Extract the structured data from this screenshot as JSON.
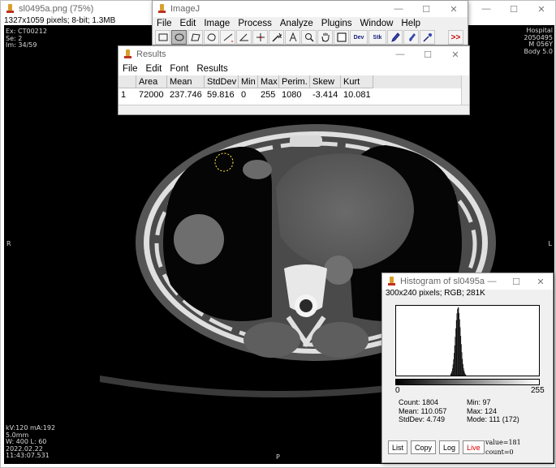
{
  "image_window": {
    "title": "sl0495a.png (75%)",
    "info": "1327x1059 pixels; 8-bit; 1.3MB",
    "overlay": {
      "top_left": [
        "Ex: CT00212",
        "Se: 2",
        "Im: 34/59"
      ],
      "top_right": [
        "Hospital",
        "2050495",
        "M 056Y",
        "Body 5.0"
      ],
      "left_marker": "R",
      "right_marker": "L",
      "bottom_marker": "P",
      "bottom_left": [
        "kV:120 mA:192",
        "5.0mm",
        "W: 400 L: 60",
        "2022.02.22",
        "11:43:07.531"
      ]
    }
  },
  "imagej_window": {
    "title": "ImageJ",
    "menus": [
      "File",
      "Edit",
      "Image",
      "Process",
      "Analyze",
      "Plugins",
      "Window",
      "Help"
    ],
    "tools": [
      "rectangle-tool",
      "oval-tool",
      "polygon-tool",
      "freehand-tool",
      "line-tool",
      "angle-tool",
      "point-tool",
      "wand-tool",
      "text-tool",
      "magnifier-tool",
      "hand-tool",
      "dropper-tool",
      "Dev",
      "Stk",
      "pencil-tool",
      "brush-tool",
      "pipette-tool"
    ],
    "dev_label": "Dev",
    "stk_label": "Stk",
    "more_label": ">>"
  },
  "results_window": {
    "title": "Results",
    "menus": [
      "File",
      "Edit",
      "Font",
      "Results"
    ],
    "columns": [
      "",
      "Area",
      "Mean",
      "StdDev",
      "Min",
      "Max",
      "Perim.",
      "Skew",
      "Kurt"
    ],
    "rows": [
      [
        "1",
        "72000",
        "237.746",
        "59.816",
        "0",
        "255",
        "1080",
        "-3.414",
        "10.081"
      ]
    ]
  },
  "histogram_window": {
    "title": "Histogram of sl0495a",
    "info": "300x240 pixels; RGB; 281K",
    "axis_min": "0",
    "axis_max": "255",
    "stats_left": [
      "Count: 1804",
      "Mean: 110.057",
      "StdDev: 4.749"
    ],
    "stats_right": [
      "Min: 97",
      "Max: 124",
      "Mode: 111 (172)"
    ],
    "buttons": [
      "List",
      "Copy",
      "Log",
      "Live"
    ],
    "value_readout": "value=181",
    "count_readout": "count=0",
    "distribution": {
      "min": 97,
      "max": 124,
      "mode": 111,
      "mode_count": 172,
      "mean": 110.057,
      "stddev": 4.749
    }
  },
  "window_buttons": {
    "minimize": "—",
    "maximize": "☐",
    "close": "✕"
  }
}
